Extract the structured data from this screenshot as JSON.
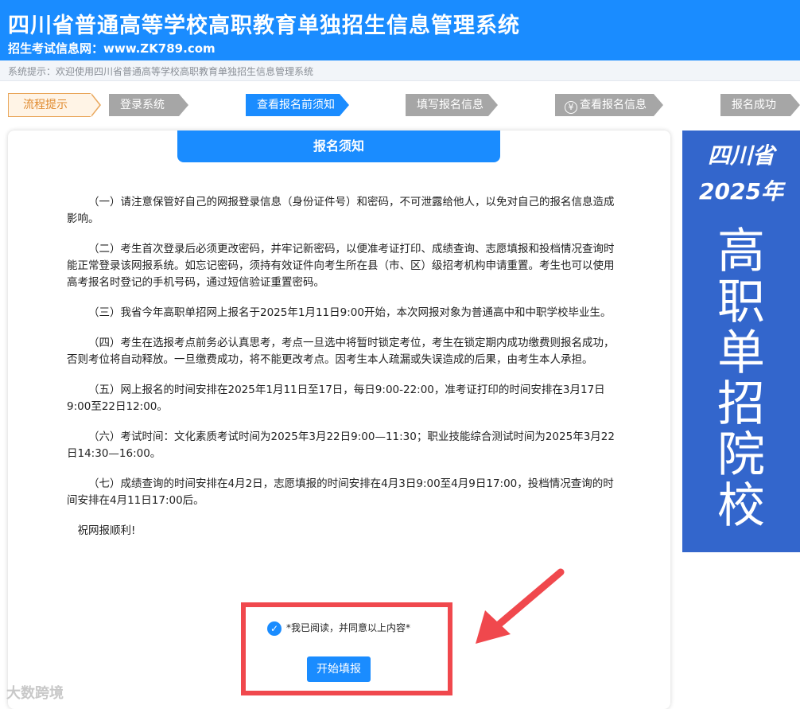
{
  "header": {
    "title": "四川省普通高等学校高职教育单独招生信息管理系统",
    "subtitle": "招生考试信息网：www.ZK789.com"
  },
  "notice": "系统提示：欢迎使用四川省普通高等学校高职教育单独招生信息管理系统",
  "steps": {
    "flow": "流程提示",
    "login": "登录系统",
    "notice_view": "查看报名前须知",
    "fill": "填写报名信息",
    "view": "查看报名信息",
    "done": "报名成功",
    "view_icon": "yen-icon"
  },
  "panel": {
    "title": "报名须知",
    "items": [
      "（一）请注意保管好自己的网报登录信息（身份证件号）和密码，不可泄露给他人，以免对自己的报名信息造成影响。",
      "（二）考生首次登录后必须更改密码，并牢记新密码，以便准考证打印、成绩查询、志愿填报和投档情况查询时能正常登录该网报系统。如忘记密码，须持有效证件向考生所在县（市、区）级招考机构申请重置。考生也可以使用高考报名时登记的手机号码，通过短信验证重置密码。",
      "（三）我省今年高职单招网上报名于2025年1月11日9:00开始，本次网报对象为普通高中和中职学校毕业生。",
      "（四）考生在选报考点前务必认真思考，考点一旦选中将暂时锁定考位，考生在锁定期内成功缴费则报名成功，否则考位将自动释放。一旦缴费成功，将不能更改考点。因考生本人疏漏或失误造成的后果，由考生本人承担。",
      "（五）网上报名的时间安排在2025年1月11日至17日，每日9:00-22:00，准考证打印的时间安排在3月17日9:00至22日12:00。",
      "（六）考试时间：文化素质考试时间为2025年3月22日9:00—11:30；职业技能综合测试时间为2025年3月22日14:30—16:00。",
      "（七）成绩查询的时间安排在4月2日，志愿填报的时间安排在4月3日9:00至4月9日17:00，投档情况查询的时间安排在4月11日17:00后。"
    ],
    "wish": "祝网报顺利!",
    "agree_label": "*我已阅读，并同意以上内容*",
    "agree_checked": true,
    "start_button": "开始填报"
  },
  "ad": {
    "line1": "四川省",
    "line2": "2025年",
    "vertical": "高职单招院校"
  },
  "watermark": "大数跨境",
  "colors": {
    "primary": "#1a8cff",
    "step_gray": "#a6a6a6",
    "flow_orange": "#e08a2e",
    "ad_blue": "#3366cc",
    "highlight_red": "#f0484d"
  }
}
